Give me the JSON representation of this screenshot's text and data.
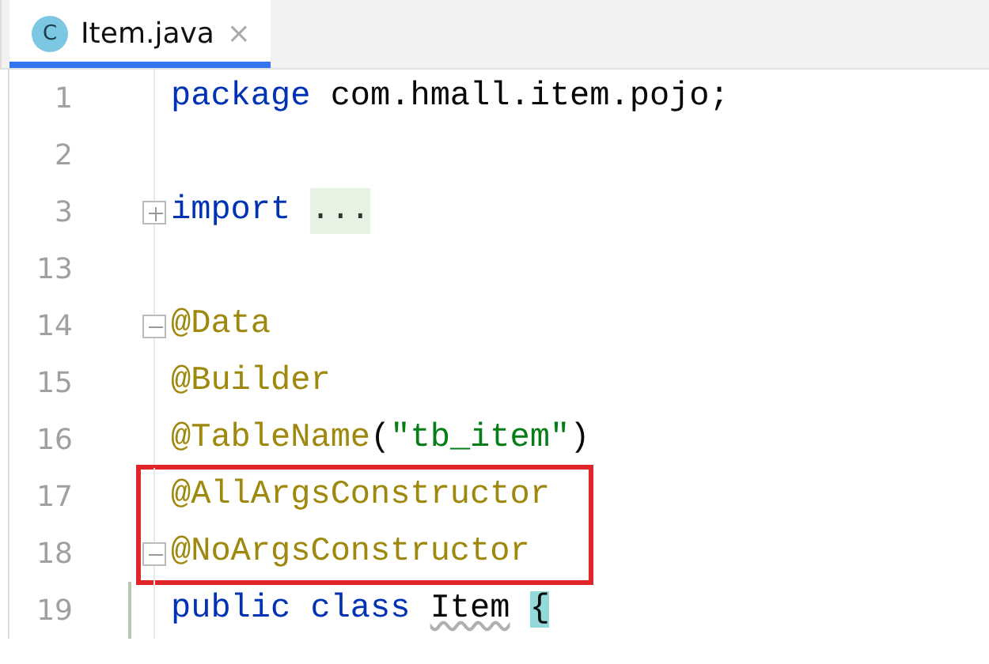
{
  "tabs": [
    {
      "icon_letter": "C",
      "label": "Item.java",
      "close": "×",
      "selected": true
    }
  ],
  "lines": [
    {
      "number": "1",
      "tokens": [
        {
          "text": "package",
          "kind": "keyword"
        },
        {
          "text": " com.hmall.item.pojo;",
          "kind": "plain"
        }
      ]
    },
    {
      "number": "2"
    },
    {
      "number": "3",
      "collapsed": true,
      "tokens": [
        {
          "text": "import ",
          "kind": "keyword"
        },
        {
          "text": "...",
          "kind": "folded"
        }
      ]
    },
    {
      "number": "13"
    },
    {
      "number": "14",
      "collapsed": false,
      "tokens": [
        {
          "text": "@Data",
          "kind": "annotation"
        }
      ]
    },
    {
      "number": "15",
      "tokens": [
        {
          "text": "@Builder",
          "kind": "annotation"
        }
      ]
    },
    {
      "number": "16",
      "tokens": [
        {
          "text": "@TableName",
          "kind": "annotation"
        },
        {
          "text": "(",
          "kind": "plain"
        },
        {
          "text": "\"tb_item\"",
          "kind": "string"
        },
        {
          "text": ")",
          "kind": "plain"
        }
      ]
    },
    {
      "number": "17",
      "boxed": true,
      "tokens": [
        {
          "text": "@AllArgsConstructor",
          "kind": "annotation"
        }
      ]
    },
    {
      "number": "18",
      "boxed": true,
      "collapsed": false,
      "tokens": [
        {
          "text": "@NoArgsConstructor",
          "kind": "annotation"
        }
      ]
    },
    {
      "number": "19",
      "changed": true,
      "tokens": [
        {
          "text": "public class ",
          "kind": "keyword"
        },
        {
          "text": "Item",
          "kind": "warning"
        },
        {
          "text": "{",
          "kind": "brace-match"
        }
      ]
    }
  ]
}
